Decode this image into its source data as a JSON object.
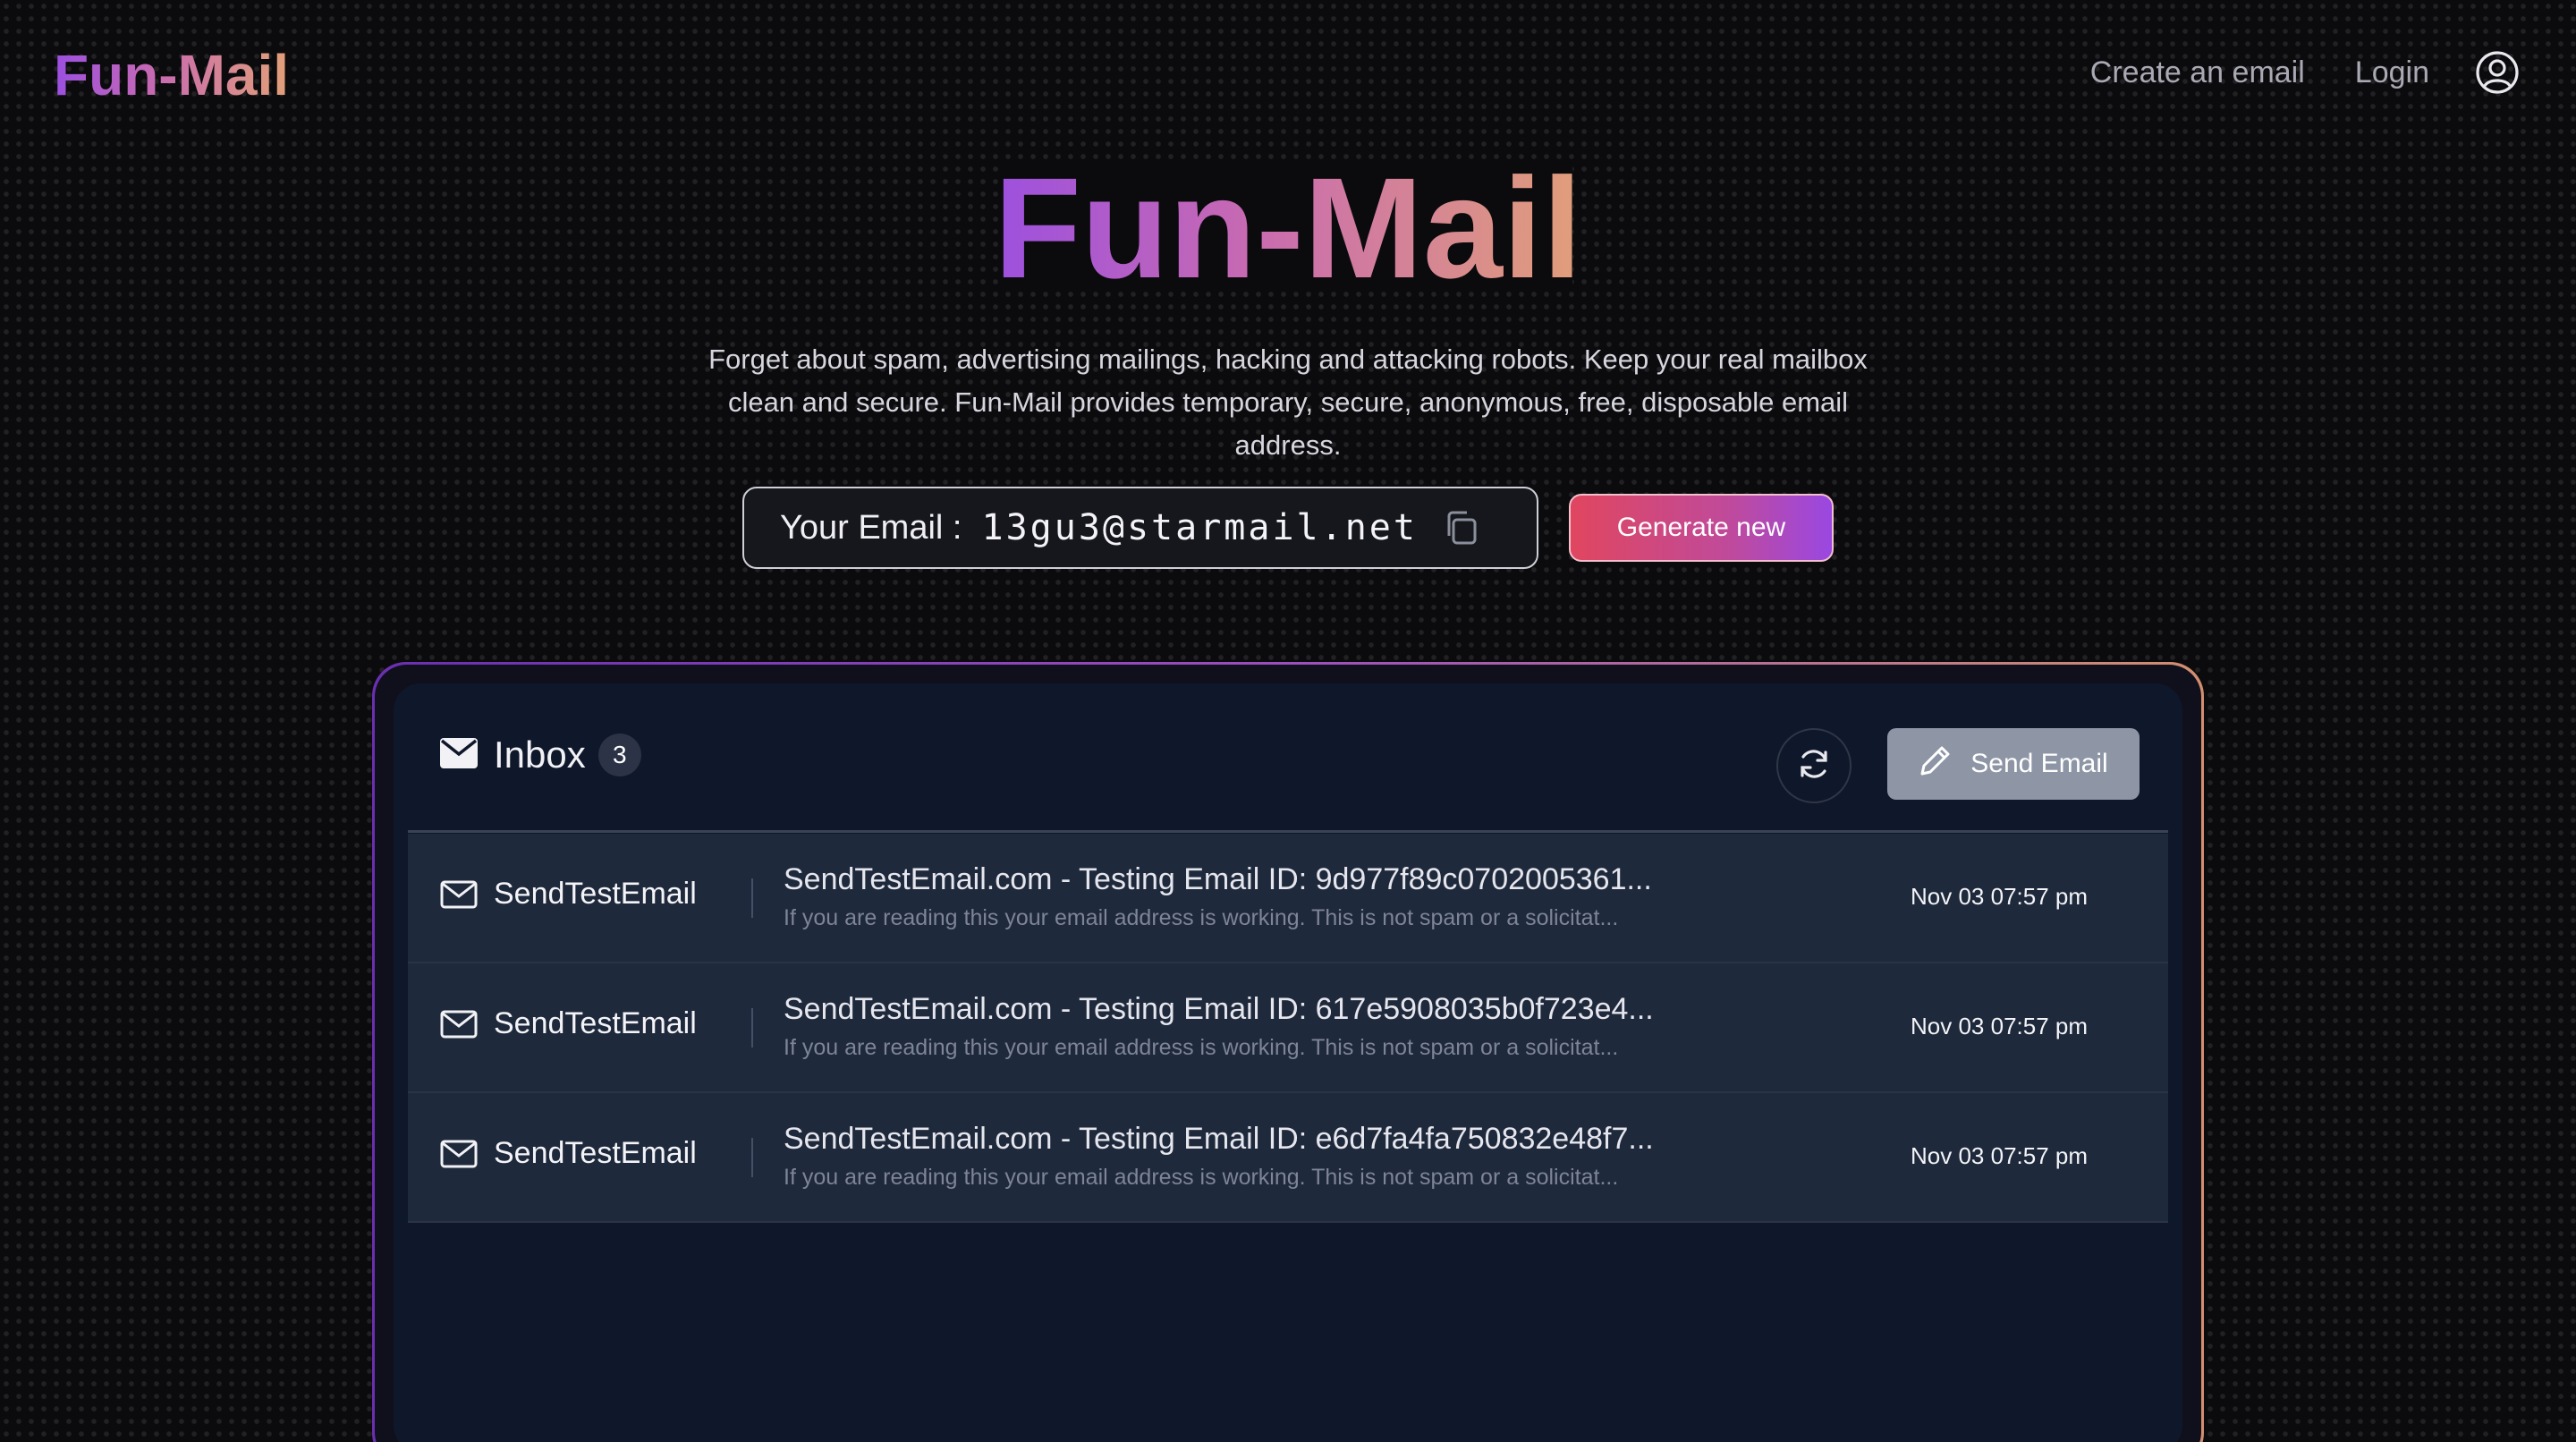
{
  "header": {
    "logo": "Fun-Mail",
    "nav": {
      "create": "Create an email",
      "login": "Login"
    }
  },
  "hero": {
    "title": "Fun-Mail",
    "tagline_line1": "Forget about spam, advertising mailings, hacking and attacking robots. Keep your real mailbox",
    "tagline_line2": "clean and secure. Fun-Mail provides temporary, secure, anonymous, free, disposable email",
    "tagline_line3": "address."
  },
  "email": {
    "label": "Your Email :",
    "value": "13gu3@starmail.net",
    "generate_label": "Generate new"
  },
  "inbox": {
    "title": "Inbox",
    "count": "3",
    "send_label": "Send Email",
    "messages": [
      {
        "sender": "SendTestEmail",
        "subject": "SendTestEmail.com - Testing Email ID: 9d977f89c0702005361...",
        "preview": "If you are reading this your email address is working. This is not spam or a solicitat...",
        "date": "Nov 03 07:57 pm"
      },
      {
        "sender": "SendTestEmail",
        "subject": "SendTestEmail.com - Testing Email ID: 617e5908035b0f723e4...",
        "preview": "If you are reading this your email address is working. This is not spam or a solicitat...",
        "date": "Nov 03 07:57 pm"
      },
      {
        "sender": "SendTestEmail",
        "subject": "SendTestEmail.com - Testing Email ID: e6d7fa4fa750832e48f7...",
        "preview": "If you are reading this your email address is working. This is not spam or a solicitat...",
        "date": "Nov 03 07:57 pm"
      }
    ]
  },
  "icons": {
    "user": "user-circle-icon",
    "copy": "copy-icon",
    "inbox": "envelope-filled-icon",
    "refresh": "refresh-icon",
    "send": "pencil-icon",
    "message": "envelope-outline-icon"
  },
  "colors": {
    "background": "#0b0b0e",
    "panel": "#0f172a",
    "row": "#1e293b",
    "brand_gradient_start": "#9b4fe0",
    "brand_gradient_end": "#e2a078",
    "generate_start": "#e0465f",
    "generate_end": "#9a48e2",
    "send_button": "#8e96a6"
  }
}
